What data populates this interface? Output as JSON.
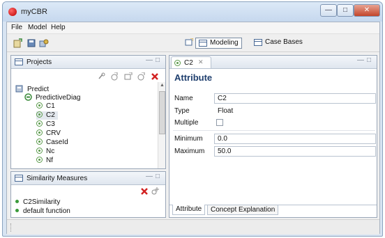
{
  "window": {
    "title": "myCBR"
  },
  "menu": [
    "File",
    "Model",
    "Help"
  ],
  "perspectives": [
    {
      "label": "Modeling",
      "active": true
    },
    {
      "label": "Case Bases",
      "active": false
    }
  ],
  "projects": {
    "title": "Projects",
    "root": "Predict",
    "concept": "PredictiveDiag",
    "attributes": [
      "C1",
      "C2",
      "C3",
      "CRV",
      "CaseId",
      "Nc",
      "Nf"
    ],
    "selected": "C2"
  },
  "similarity": {
    "title": "Similarity Measures",
    "items": [
      "C2Similarity",
      "default function"
    ]
  },
  "editor": {
    "tab_label": "C2",
    "heading": "Attribute",
    "name_label": "Name",
    "name_value": "C2",
    "type_label": "Type",
    "type_value": "Float",
    "multiple_label": "Multiple",
    "minimum_label": "Minimum",
    "minimum_value": "0.0",
    "maximum_label": "Maximum",
    "maximum_value": "50.0",
    "bottom_tabs": [
      "Attribute",
      "Concept Explanation"
    ]
  },
  "icons": {
    "app": "mycbr-red-ball-icon",
    "delete": "red-x-icon",
    "add": "add-icon"
  },
  "colors": {
    "accent": "#1f3f6e",
    "delete": "#d22222"
  }
}
